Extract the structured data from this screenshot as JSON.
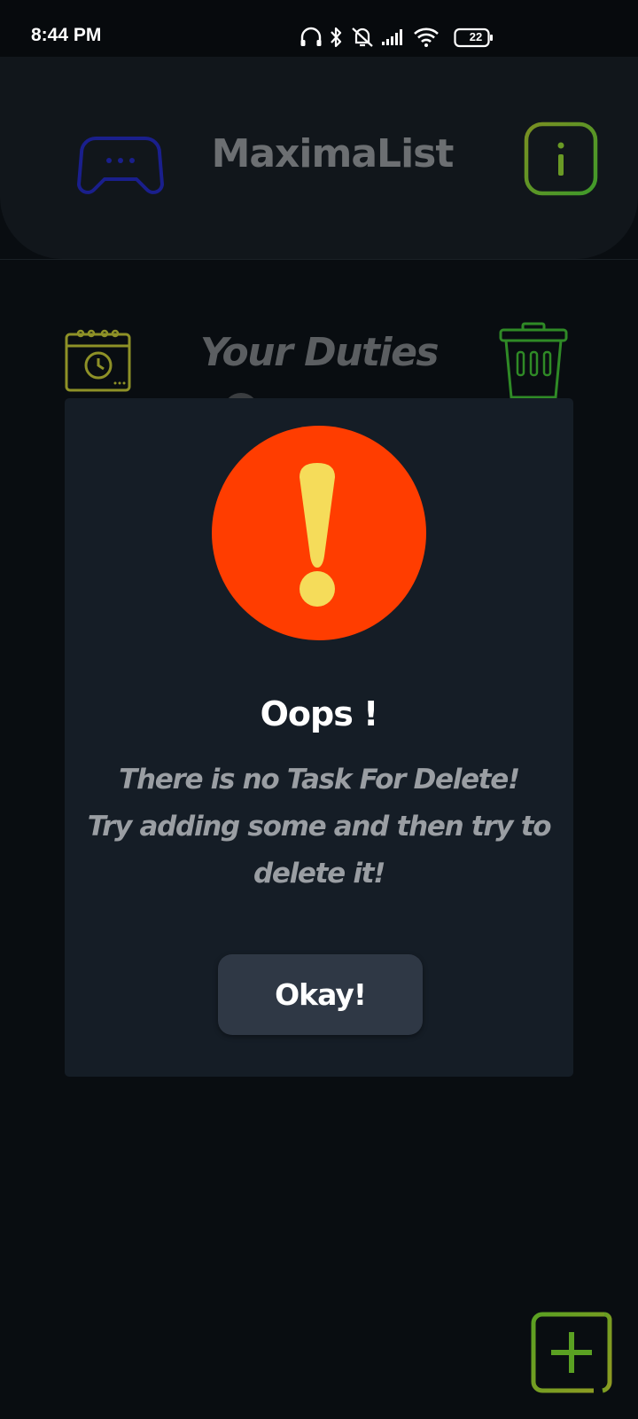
{
  "status_bar": {
    "time": "8:44 PM",
    "battery": "22",
    "icons": [
      "headphones-icon",
      "bluetooth-icon",
      "mute-icon",
      "cell-signal-icon",
      "wifi-icon",
      "battery-icon"
    ]
  },
  "header": {
    "title": "MaximaList",
    "left_icon": "gamepad-icon",
    "right_icon": "info-icon"
  },
  "main": {
    "title": "Your Duties",
    "left_icon": "calendar-history-icon",
    "right_icon": "trash-icon",
    "fab_icon": "add-icon"
  },
  "dialog": {
    "icon": "warning-exclamation-icon",
    "title": "Oops !",
    "message": "There is no Task For Delete!\nTry adding some and then try to\ndelete it!",
    "button_label": "Okay!"
  },
  "colors": {
    "warning_circle": "#ff3d00",
    "warning_mark": "#f5dc5a",
    "gamepad_blue": "#1a1f8c",
    "info_green": "#5d9a2b",
    "trash_green": "#2f8a26",
    "calendar_yellow": "#8e9127",
    "add_green": "#5aa022"
  }
}
